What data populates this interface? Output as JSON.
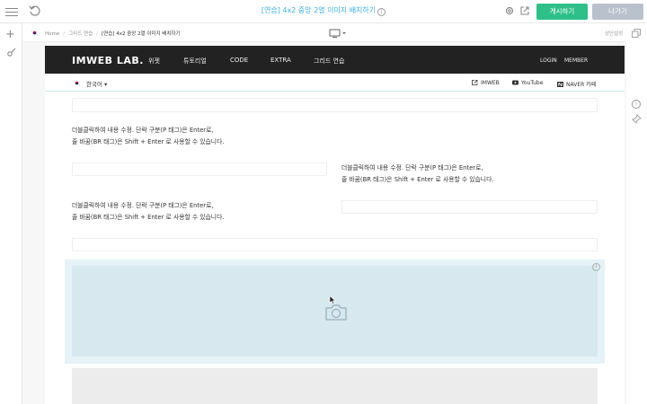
{
  "topbar": {
    "title": "[연습] 4x2 중앙 2열 이미지 배치하기",
    "publish_label": "게시하기",
    "exit_label": "나가기"
  },
  "breadcrumb": {
    "items": [
      "Home",
      "그리드 연습",
      "[연습] 4x2 중앙 2열 이미지 배치하기"
    ],
    "tablet_setting": "상단설정"
  },
  "site": {
    "logo": "IMWEB LAB.",
    "nav": [
      "위젯",
      "튜토리얼",
      "CODE",
      "EXTRA",
      "그리드 연습"
    ],
    "login": "LOGIN",
    "member": "MEMBER",
    "language": "한국어 ▾",
    "links": [
      "IMWEB",
      "YouTube",
      "NAVER 카페"
    ]
  },
  "content": {
    "para_line1": "더블클릭하여 내용 수정. 단락 구분(P 태그)은 Enter로,",
    "para_line2": "줄 바꿈(BR 태그)은 Shift + Enter 로 사용할 수 있습니다."
  },
  "colors": {
    "accent": "#3aaee0",
    "publish": "#2fc08a",
    "exit": "#b9c2cc",
    "header": "#222222"
  },
  "icons": [
    "menu-icon",
    "undo-icon",
    "info-icon",
    "gear-icon",
    "external-link-icon",
    "plus-icon",
    "brush-icon",
    "pin-icon",
    "desktop-icon",
    "copy-icon",
    "camera-icon",
    "cursor-icon",
    "korea-flag-icon",
    "youtube-icon",
    "naver-icon"
  ]
}
